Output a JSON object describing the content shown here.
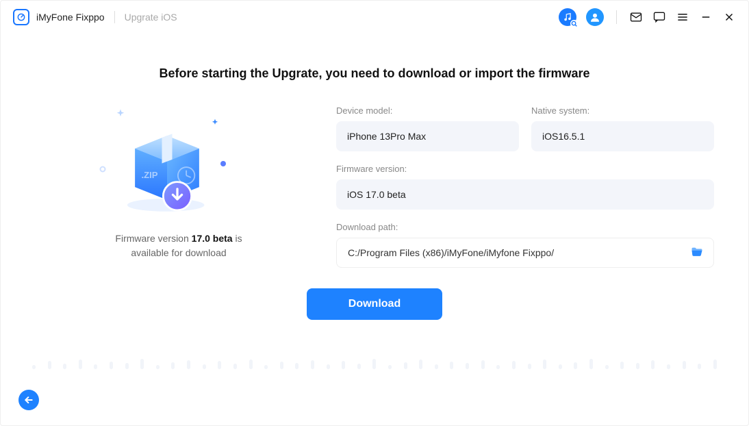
{
  "header": {
    "app_name": "iMyFone Fixppo",
    "page_name": "Upgrate iOS"
  },
  "main": {
    "headline": "Before starting the Upgrate, you need to download or import the firmware",
    "left": {
      "line1_prefix": "Firmware version ",
      "line1_bold": "17.0 beta",
      "line1_suffix": "  is",
      "line2": "available for download"
    },
    "fields": {
      "device_model_label": "Device model:",
      "device_model_value": "iPhone 13Pro Max",
      "native_system_label": "Native system:",
      "native_system_value": "iOS16.5.1",
      "firmware_version_label": "Firmware version:",
      "firmware_version_value": "iOS 17.0 beta",
      "download_path_label": "Download path:",
      "download_path_value": "C:/Program Files (x86)/iMyFone/iMyfone Fixppo/"
    },
    "download_button": "Download"
  }
}
